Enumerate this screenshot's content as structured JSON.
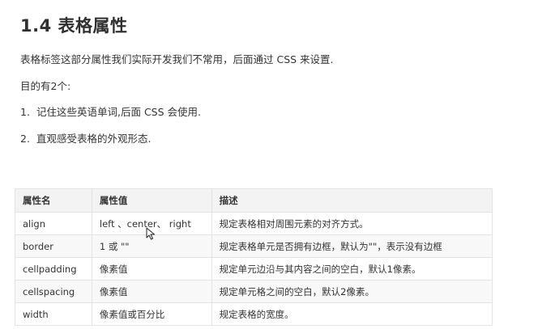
{
  "section": {
    "heading": "1.4 表格属性",
    "intro": "表格标签这部分属性我们实际开发我们不常用，后面通过 CSS 来设置.",
    "purpose_label": "目的有2个:",
    "goals": [
      {
        "num": "1.",
        "text": "记住这些英语单词,后面 CSS 会使用."
      },
      {
        "num": "2.",
        "text": "直观感受表格的外观形态."
      }
    ]
  },
  "table": {
    "headers": [
      "属性名",
      "属性值",
      "描述"
    ],
    "rows": [
      [
        "align",
        "left 、center、 right",
        "规定表格相对周围元素的对齐方式。"
      ],
      [
        "border",
        "1 或 \"\"",
        "规定表格单元是否拥有边框，默认为\"\"，表示没有边框"
      ],
      [
        "cellpadding",
        "像素值",
        "规定单元边沿与其内容之间的空白，默认1像素。"
      ],
      [
        "cellspacing",
        "像素值",
        "规定单元格之间的空白，默认2像素。"
      ],
      [
        "width",
        "像素值或百分比",
        "规定表格的宽度。"
      ]
    ]
  },
  "colors": {
    "text": "#333333",
    "header_bg": "#f3f3f3",
    "stripe_bg": "#f8f8f8",
    "border": "#e3e3e3"
  },
  "icons": {
    "cursor": "mouse-pointer-icon"
  }
}
